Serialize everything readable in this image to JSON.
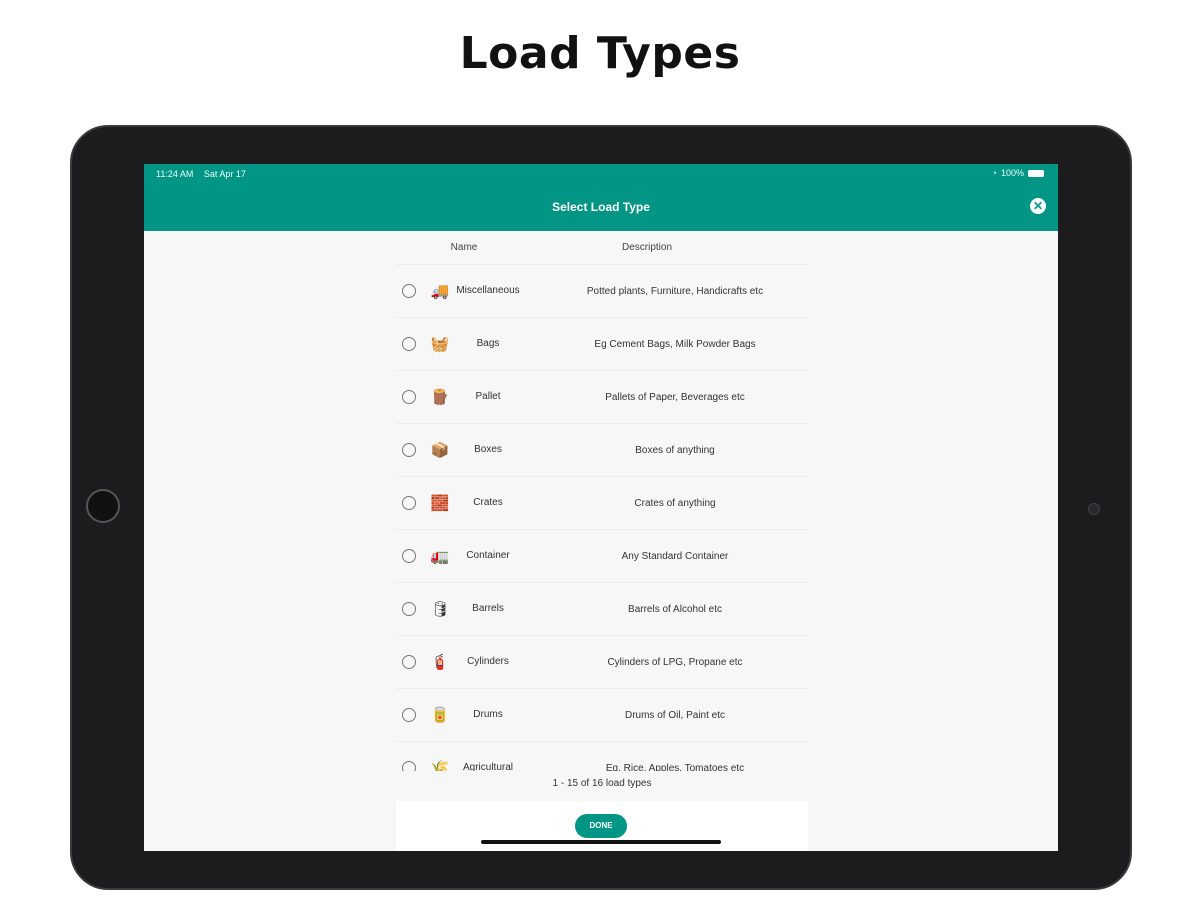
{
  "heading": "Load Types",
  "status_bar": {
    "time": "11:24 AM",
    "date": "Sat Apr 17",
    "battery": "100%"
  },
  "header": {
    "title": "Select Load Type"
  },
  "columns": {
    "name": "Name",
    "description": "Description"
  },
  "rows": [
    {
      "icon": "🚚",
      "name": "Miscellaneous",
      "description": "Potted plants, Furniture, Handicrafts etc"
    },
    {
      "icon": "🧺",
      "name": "Bags",
      "description": "Eg Cement Bags, Milk Powder Bags"
    },
    {
      "icon": "🪵",
      "name": "Pallet",
      "description": "Pallets of Paper, Beverages etc"
    },
    {
      "icon": "📦",
      "name": "Boxes",
      "description": "Boxes of anything"
    },
    {
      "icon": "🧱",
      "name": "Crates",
      "description": "Crates of anything"
    },
    {
      "icon": "🚛",
      "name": "Container",
      "description": "Any Standard Container"
    },
    {
      "icon": "🛢",
      "name": "Barrels",
      "description": "Barrels of Alcohol etc"
    },
    {
      "icon": "🧯",
      "name": "Cylinders",
      "description": "Cylinders of LPG, Propane etc"
    },
    {
      "icon": "🥫",
      "name": "Drums",
      "description": "Drums of Oil, Paint etc"
    },
    {
      "icon": "🌾",
      "name": "Agricultural",
      "description": "Eg. Rice, Apples, Tomatoes etc"
    }
  ],
  "count_text": "1 - 15 of 16 load types",
  "done_label": "DONE"
}
